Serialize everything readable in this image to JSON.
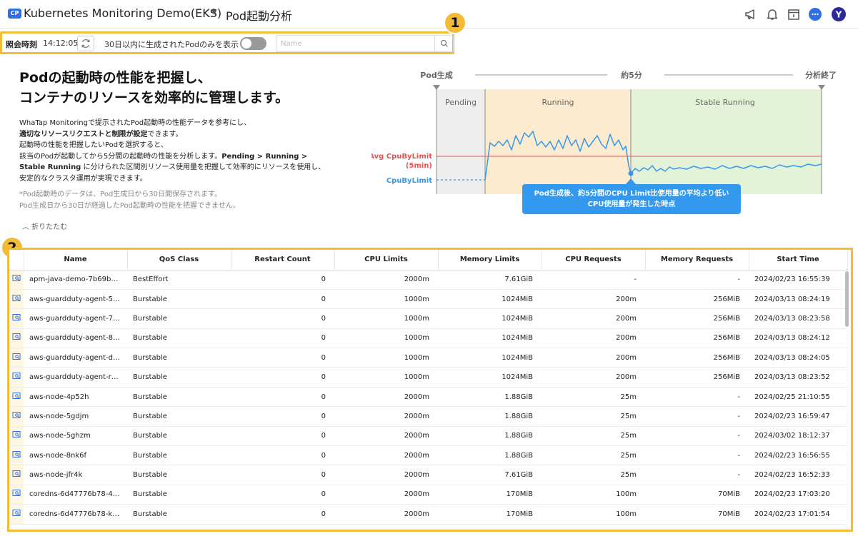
{
  "header": {
    "project_badge": "CP",
    "project_name": "Kubernetes Monitoring Demo(EKS)",
    "page_title": "Pod起動分析",
    "user_initial": "Y"
  },
  "toolbar": {
    "query_label": "照会時刻",
    "query_time": "14:12:05",
    "filter_label": "30日以内に生成されたPodのみを表示",
    "search_placeholder": "Name",
    "search_value": ""
  },
  "badges": {
    "one": "1",
    "two": "2"
  },
  "intro": {
    "heading_line1": "Podの起動時の性能を把握し、",
    "heading_line2": "コンテナのリソースを効率的に管理します。",
    "p1": "WhaTap Monitoringで提示されたPod起動時の性能データを参考にし、",
    "p2_bold": "適切なリソースリクエストと制限が設定",
    "p2_rest": "できます。",
    "p3": "起動時の性能を把握したいPodを選択すると、",
    "p4_pre": "該当のPodが起動してから5分間の起動時の性能を分析します。",
    "p4_bold": "Pending > Running >",
    "p5_bold": "Stable Running",
    "p5_rest": " に分けられた区間別リソース使用量を把握して効率的にリソースを使用し、",
    "p6": "安定的なクラスタ運用が実現できます。",
    "note1": "*Pod起動時のデータは、Pod生成日から30日間保存されます。",
    "note2": "Pod生成日から30日が経過したPod起動時の性能を把握できません。",
    "collapse": "折りたたむ"
  },
  "diagram": {
    "label_start": "Pod生成",
    "label_mid": "約5分",
    "label_end": "分析終了",
    "phase_pending": "Pending",
    "phase_running": "Running",
    "phase_stable": "Stable Running",
    "avg_label_1": "Avg CpuByLimit",
    "avg_label_2": "(5min)",
    "cpu_label": "CpuByLimit",
    "callout_1": "Pod生成後、約5分間のCPU Limit比使用量の平均より低い",
    "callout_2": "CPU使用量が発生した時点",
    "colors": {
      "pending": "#eeeeee",
      "running": "#fdebd0",
      "stable": "#e4f3d8",
      "line": "#3399ee",
      "avg": "#e55353"
    }
  },
  "table": {
    "columns": [
      "Name",
      "QoS Class",
      "Restart Count",
      "CPU Limits",
      "Memory Limits",
      "CPU Requests",
      "Memory Requests",
      "Start Time"
    ],
    "rows": [
      [
        "apm-java-demo-7b69b48...",
        "BestEffort",
        "0",
        "2000m",
        "7.61GiB",
        "-",
        "-",
        "2024/02/23 16:55:39"
      ],
      [
        "aws-guardduty-agent-5cq...",
        "Burstable",
        "0",
        "1000m",
        "1024MiB",
        "200m",
        "256MiB",
        "2024/03/13 08:24:19"
      ],
      [
        "aws-guardduty-agent-76g...",
        "Burstable",
        "0",
        "1000m",
        "1024MiB",
        "200m",
        "256MiB",
        "2024/03/13 08:23:58"
      ],
      [
        "aws-guardduty-agent-8r4...",
        "Burstable",
        "0",
        "1000m",
        "1024MiB",
        "200m",
        "256MiB",
        "2024/03/13 08:24:12"
      ],
      [
        "aws-guardduty-agent-dhf...",
        "Burstable",
        "0",
        "1000m",
        "1024MiB",
        "200m",
        "256MiB",
        "2024/03/13 08:24:05"
      ],
      [
        "aws-guardduty-agent-rbm...",
        "Burstable",
        "0",
        "1000m",
        "1024MiB",
        "200m",
        "256MiB",
        "2024/03/13 08:23:52"
      ],
      [
        "aws-node-4p52h",
        "Burstable",
        "0",
        "2000m",
        "1.88GiB",
        "25m",
        "-",
        "2024/02/25 21:10:55"
      ],
      [
        "aws-node-5gdjm",
        "Burstable",
        "0",
        "2000m",
        "1.88GiB",
        "25m",
        "-",
        "2024/02/23 16:59:47"
      ],
      [
        "aws-node-5ghzm",
        "Burstable",
        "0",
        "2000m",
        "1.88GiB",
        "25m",
        "-",
        "2024/03/02 18:12:37"
      ],
      [
        "aws-node-8nk6f",
        "Burstable",
        "0",
        "2000m",
        "1.88GiB",
        "25m",
        "-",
        "2024/02/23 16:56:55"
      ],
      [
        "aws-node-jfr4k",
        "Burstable",
        "0",
        "2000m",
        "7.61GiB",
        "25m",
        "-",
        "2024/02/23 16:52:33"
      ],
      [
        "coredns-6d47776b78-4v4...",
        "Burstable",
        "0",
        "2000m",
        "170MiB",
        "100m",
        "70MiB",
        "2024/02/23 17:03:20"
      ],
      [
        "coredns-6d47776b78-kb9...",
        "Burstable",
        "0",
        "2000m",
        "170MiB",
        "100m",
        "70MiB",
        "2024/02/23 17:01:54"
      ]
    ]
  }
}
